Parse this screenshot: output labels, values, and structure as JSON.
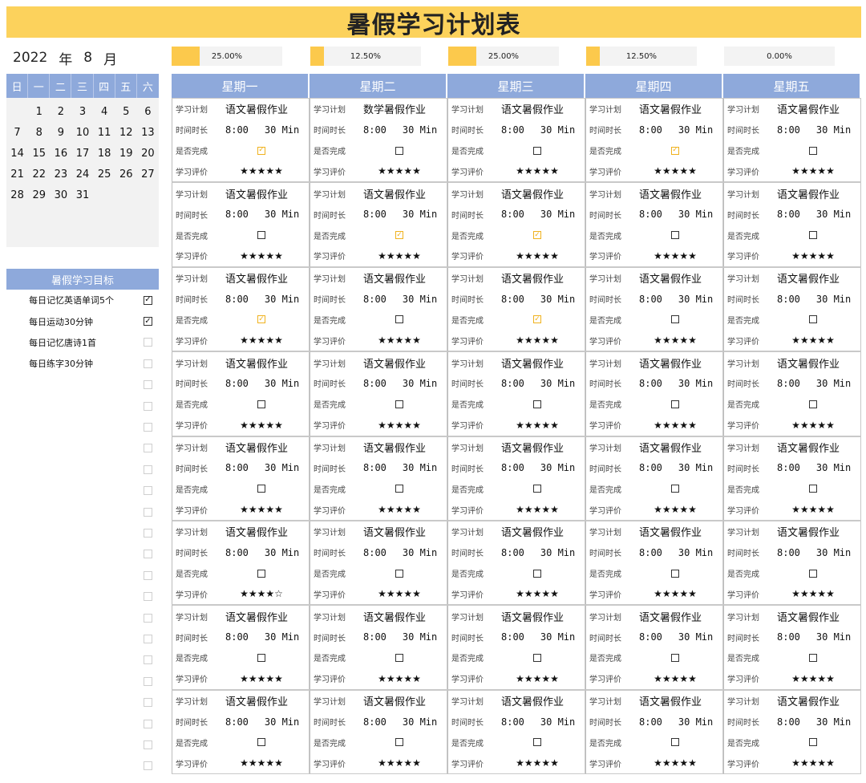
{
  "title": "暑假学习计划表",
  "date_header": {
    "year": "2022",
    "year_label": "年",
    "month": "8",
    "month_label": "月"
  },
  "calendar": {
    "weekday_headers": [
      "日",
      "一",
      "二",
      "三",
      "四",
      "五",
      "六"
    ],
    "leading_blanks": 1,
    "days": [
      "1",
      "2",
      "3",
      "4",
      "5",
      "6",
      "7",
      "8",
      "9",
      "10",
      "11",
      "12",
      "13",
      "14",
      "15",
      "16",
      "17",
      "18",
      "19",
      "20",
      "21",
      "22",
      "23",
      "24",
      "25",
      "26",
      "27",
      "28",
      "29",
      "30",
      "31"
    ]
  },
  "goals": {
    "header": "暑假学习目标",
    "items": [
      {
        "label": "每日记忆英语单词5个",
        "checked": true
      },
      {
        "label": "每日运动30分钟",
        "checked": true
      },
      {
        "label": "每日记忆唐诗1首",
        "checked": false
      },
      {
        "label": "每日练字30分钟",
        "checked": false
      },
      {
        "label": "",
        "checked": false
      },
      {
        "label": "",
        "checked": false
      },
      {
        "label": "",
        "checked": false
      },
      {
        "label": "",
        "checked": false
      },
      {
        "label": "",
        "checked": false
      },
      {
        "label": "",
        "checked": false
      },
      {
        "label": "",
        "checked": false
      },
      {
        "label": "",
        "checked": false
      },
      {
        "label": "",
        "checked": false
      },
      {
        "label": "",
        "checked": false
      },
      {
        "label": "",
        "checked": false
      },
      {
        "label": "",
        "checked": false
      },
      {
        "label": "",
        "checked": false
      },
      {
        "label": "",
        "checked": false
      },
      {
        "label": "",
        "checked": false
      },
      {
        "label": "",
        "checked": false
      },
      {
        "label": "",
        "checked": false
      },
      {
        "label": "",
        "checked": false
      },
      {
        "label": "",
        "checked": false
      },
      {
        "label": "",
        "checked": false
      }
    ]
  },
  "progress": [
    {
      "label": "25.00%",
      "fraction": 0.25
    },
    {
      "label": "12.50%",
      "fraction": 0.125
    },
    {
      "label": "25.00%",
      "fraction": 0.25
    },
    {
      "label": "12.50%",
      "fraction": 0.125
    },
    {
      "label": "0.00%",
      "fraction": 0
    }
  ],
  "field_labels": {
    "plan": "学习计划",
    "duration": "时间时长",
    "done": "是否完成",
    "rating": "学习评价"
  },
  "default_task": {
    "task": "语文暑假作业",
    "time": "8:00",
    "duration": "30 Min"
  },
  "days": [
    {
      "name": "星期一"
    },
    {
      "name": "星期二"
    },
    {
      "name": "星期三"
    },
    {
      "name": "星期四"
    },
    {
      "name": "星期五"
    }
  ],
  "rows": [
    [
      {
        "task": "语文暑假作业",
        "done": true,
        "stars": "★★★★★"
      },
      {
        "task": "数学暑假作业",
        "done": false,
        "stars": "★★★★★"
      },
      {
        "task": "语文暑假作业",
        "done": false,
        "stars": "★★★★★"
      },
      {
        "task": "语文暑假作业",
        "done": true,
        "stars": "★★★★★"
      },
      {
        "task": "语文暑假作业",
        "done": false,
        "stars": "★★★★★"
      }
    ],
    [
      {
        "task": "语文暑假作业",
        "done": false,
        "stars": "★★★★★"
      },
      {
        "task": "语文暑假作业",
        "done": true,
        "stars": "★★★★★"
      },
      {
        "task": "语文暑假作业",
        "done": true,
        "stars": "★★★★★"
      },
      {
        "task": "语文暑假作业",
        "done": false,
        "stars": "★★★★★"
      },
      {
        "task": "语文暑假作业",
        "done": false,
        "stars": "★★★★★"
      }
    ],
    [
      {
        "task": "语文暑假作业",
        "done": true,
        "stars": "★★★★★"
      },
      {
        "task": "语文暑假作业",
        "done": false,
        "stars": "★★★★★"
      },
      {
        "task": "语文暑假作业",
        "done": true,
        "stars": "★★★★★"
      },
      {
        "task": "语文暑假作业",
        "done": false,
        "stars": "★★★★★"
      },
      {
        "task": "语文暑假作业",
        "done": false,
        "stars": "★★★★★"
      }
    ],
    [
      {
        "task": "语文暑假作业",
        "done": false,
        "stars": "★★★★★"
      },
      {
        "task": "语文暑假作业",
        "done": false,
        "stars": "★★★★★"
      },
      {
        "task": "语文暑假作业",
        "done": false,
        "stars": "★★★★★"
      },
      {
        "task": "语文暑假作业",
        "done": false,
        "stars": "★★★★★"
      },
      {
        "task": "语文暑假作业",
        "done": false,
        "stars": "★★★★★"
      }
    ],
    [
      {
        "task": "语文暑假作业",
        "done": false,
        "stars": "★★★★★"
      },
      {
        "task": "语文暑假作业",
        "done": false,
        "stars": "★★★★★"
      },
      {
        "task": "语文暑假作业",
        "done": false,
        "stars": "★★★★★"
      },
      {
        "task": "语文暑假作业",
        "done": false,
        "stars": "★★★★★"
      },
      {
        "task": "语文暑假作业",
        "done": false,
        "stars": "★★★★★"
      }
    ],
    [
      {
        "task": "语文暑假作业",
        "done": false,
        "stars": "★★★★☆"
      },
      {
        "task": "语文暑假作业",
        "done": false,
        "stars": "★★★★★"
      },
      {
        "task": "语文暑假作业",
        "done": false,
        "stars": "★★★★★"
      },
      {
        "task": "语文暑假作业",
        "done": false,
        "stars": "★★★★★"
      },
      {
        "task": "语文暑假作业",
        "done": false,
        "stars": "★★★★★"
      }
    ],
    [
      {
        "task": "语文暑假作业",
        "done": false,
        "stars": "★★★★★"
      },
      {
        "task": "语文暑假作业",
        "done": false,
        "stars": "★★★★★"
      },
      {
        "task": "语文暑假作业",
        "done": false,
        "stars": "★★★★★"
      },
      {
        "task": "语文暑假作业",
        "done": false,
        "stars": "★★★★★"
      },
      {
        "task": "语文暑假作业",
        "done": false,
        "stars": "★★★★★"
      }
    ],
    [
      {
        "task": "语文暑假作业",
        "done": false,
        "stars": "★★★★★"
      },
      {
        "task": "语文暑假作业",
        "done": false,
        "stars": "★★★★★"
      },
      {
        "task": "语文暑假作业",
        "done": false,
        "stars": "★★★★★"
      },
      {
        "task": "语文暑假作业",
        "done": false,
        "stars": "★★★★★"
      },
      {
        "task": "语文暑假作业",
        "done": false,
        "stars": "★★★★★"
      }
    ]
  ],
  "colors": {
    "title_bg": "#fcd25c",
    "header_blue": "#8ea9db",
    "progress_fill": "#fcc94c",
    "check_orange": "#f0b21e"
  }
}
